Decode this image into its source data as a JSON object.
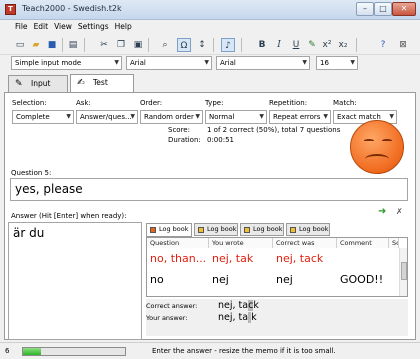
{
  "window": {
    "app_name": "Teach2000",
    "separator": "-",
    "file_name": "Swedish.t2k",
    "app_icon": "T"
  },
  "menu": [
    "File",
    "Edit",
    "View",
    "Settings",
    "Help"
  ],
  "toolbar": {
    "icons": [
      "new-file-icon",
      "open-folder-icon",
      "save-icon",
      "print-icon",
      "cut-icon",
      "copy-icon",
      "paste-icon",
      "find-icon",
      "swap-icon",
      "sort-icon",
      "music-note-icon",
      "bold-icon",
      "italic-icon",
      "underline-icon",
      "highlight-icon",
      "superscript-icon",
      "subscript-icon",
      "help-icon",
      "close-icon"
    ],
    "bold": "B",
    "italic": "I",
    "underline": "U",
    "superscript": "x²",
    "subscript": "x₂"
  },
  "format": {
    "input_mode": "Simple input mode",
    "font_left": "Arial",
    "font_right": "Arial",
    "size": "16"
  },
  "tabs": [
    {
      "label": "Input",
      "active": false
    },
    {
      "label": "Test",
      "active": true
    }
  ],
  "options": {
    "selection": {
      "label": "Selection:",
      "value": "Complete"
    },
    "ask": {
      "label": "Ask:",
      "value": "Answer/ques..."
    },
    "order": {
      "label": "Order:",
      "value": "Random order"
    },
    "type": {
      "label": "Type:",
      "value": "Normal"
    },
    "repetition": {
      "label": "Repetition:",
      "value": "Repeat errors"
    },
    "match": {
      "label": "Match:",
      "value": "Exact match"
    }
  },
  "stats": {
    "score_label": "Score:",
    "score_value": "1 of 2 correct (50%), total 7 questions",
    "duration_label": "Duration:",
    "duration_value": "0:00:51"
  },
  "question": {
    "label": "Question 5:",
    "text": "yes, please"
  },
  "answer": {
    "label": "Answer (Hit [Enter] when ready):",
    "text": "är du"
  },
  "logbook": {
    "tabs": [
      "Log book",
      "Log book",
      "Log book",
      "Log book"
    ],
    "tab_colors": [
      "#e8641c",
      "#f0c030",
      "#f0c030",
      "#f0c030"
    ],
    "columns": [
      "Question",
      "You wrote",
      "Correct was",
      "Comment",
      "Sc"
    ],
    "rows": [
      {
        "question": "no, than...",
        "wrote": "nej, tak",
        "correct": "nej, tack",
        "comment": "",
        "color": "#e02010"
      },
      {
        "question": "no",
        "wrote": "nej",
        "correct": "nej",
        "comment": "GOOD!!",
        "color": "#000000"
      }
    ]
  },
  "compare": {
    "correct_label": "Correct answer:",
    "correct_before": "nej, ta",
    "correct_hl": "c",
    "correct_after": "k",
    "your_label": "Your answer:",
    "your_before": "nej, ta",
    "your_hl": " ",
    "your_after": "k"
  },
  "status": {
    "count": "6",
    "progress": 0.18,
    "message": "Enter the answer - resize the memo if it is too small."
  }
}
